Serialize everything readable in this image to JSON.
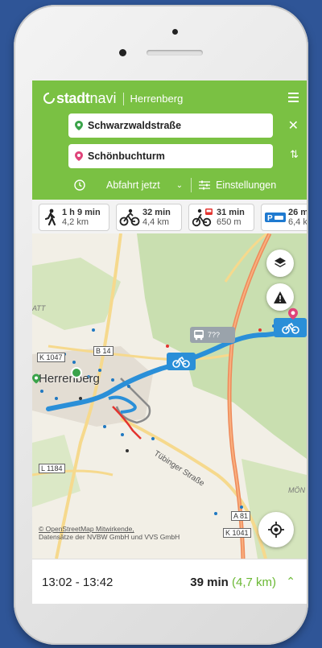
{
  "app": {
    "brand_bold": "stadt",
    "brand_light": "navi",
    "city": "Herrenberg"
  },
  "route": {
    "from": "Schwarzwaldstraße",
    "to": "Schönbuchturm"
  },
  "options": {
    "departure": "Abfahrt jetzt",
    "settings": "Einstellungen"
  },
  "modes": [
    {
      "time": "1 h 9 min",
      "dist": "4,2 km",
      "icon": "walk-icon"
    },
    {
      "time": "32 min",
      "dist": "4,4 km",
      "icon": "bike-icon"
    },
    {
      "time": "31 min",
      "dist": "650 m",
      "icon": "bike-transit-icon"
    },
    {
      "time": "26 m",
      "dist": "6,4 k",
      "icon": "park-and-ride-icon"
    }
  ],
  "map": {
    "place": "Herrenberg",
    "labels": [
      "K 1047",
      "B 14",
      "L 1184",
      "A 81",
      "K 1041",
      "Tübinger Straße",
      "ATT",
      "MÖN",
      "7??"
    ],
    "attribution_1": "© OpenStreetMap Mitwirkende,",
    "attribution_2": "Datensätze der NVBW GmbH und VVS GmbH"
  },
  "summary": {
    "time_range": "13:02 - 13:42",
    "duration": "39 min",
    "distance": "(4,7 km)"
  },
  "colors": {
    "brand": "#7ac143",
    "route": "#2a8fd8",
    "accent_green": "#6ab833"
  }
}
